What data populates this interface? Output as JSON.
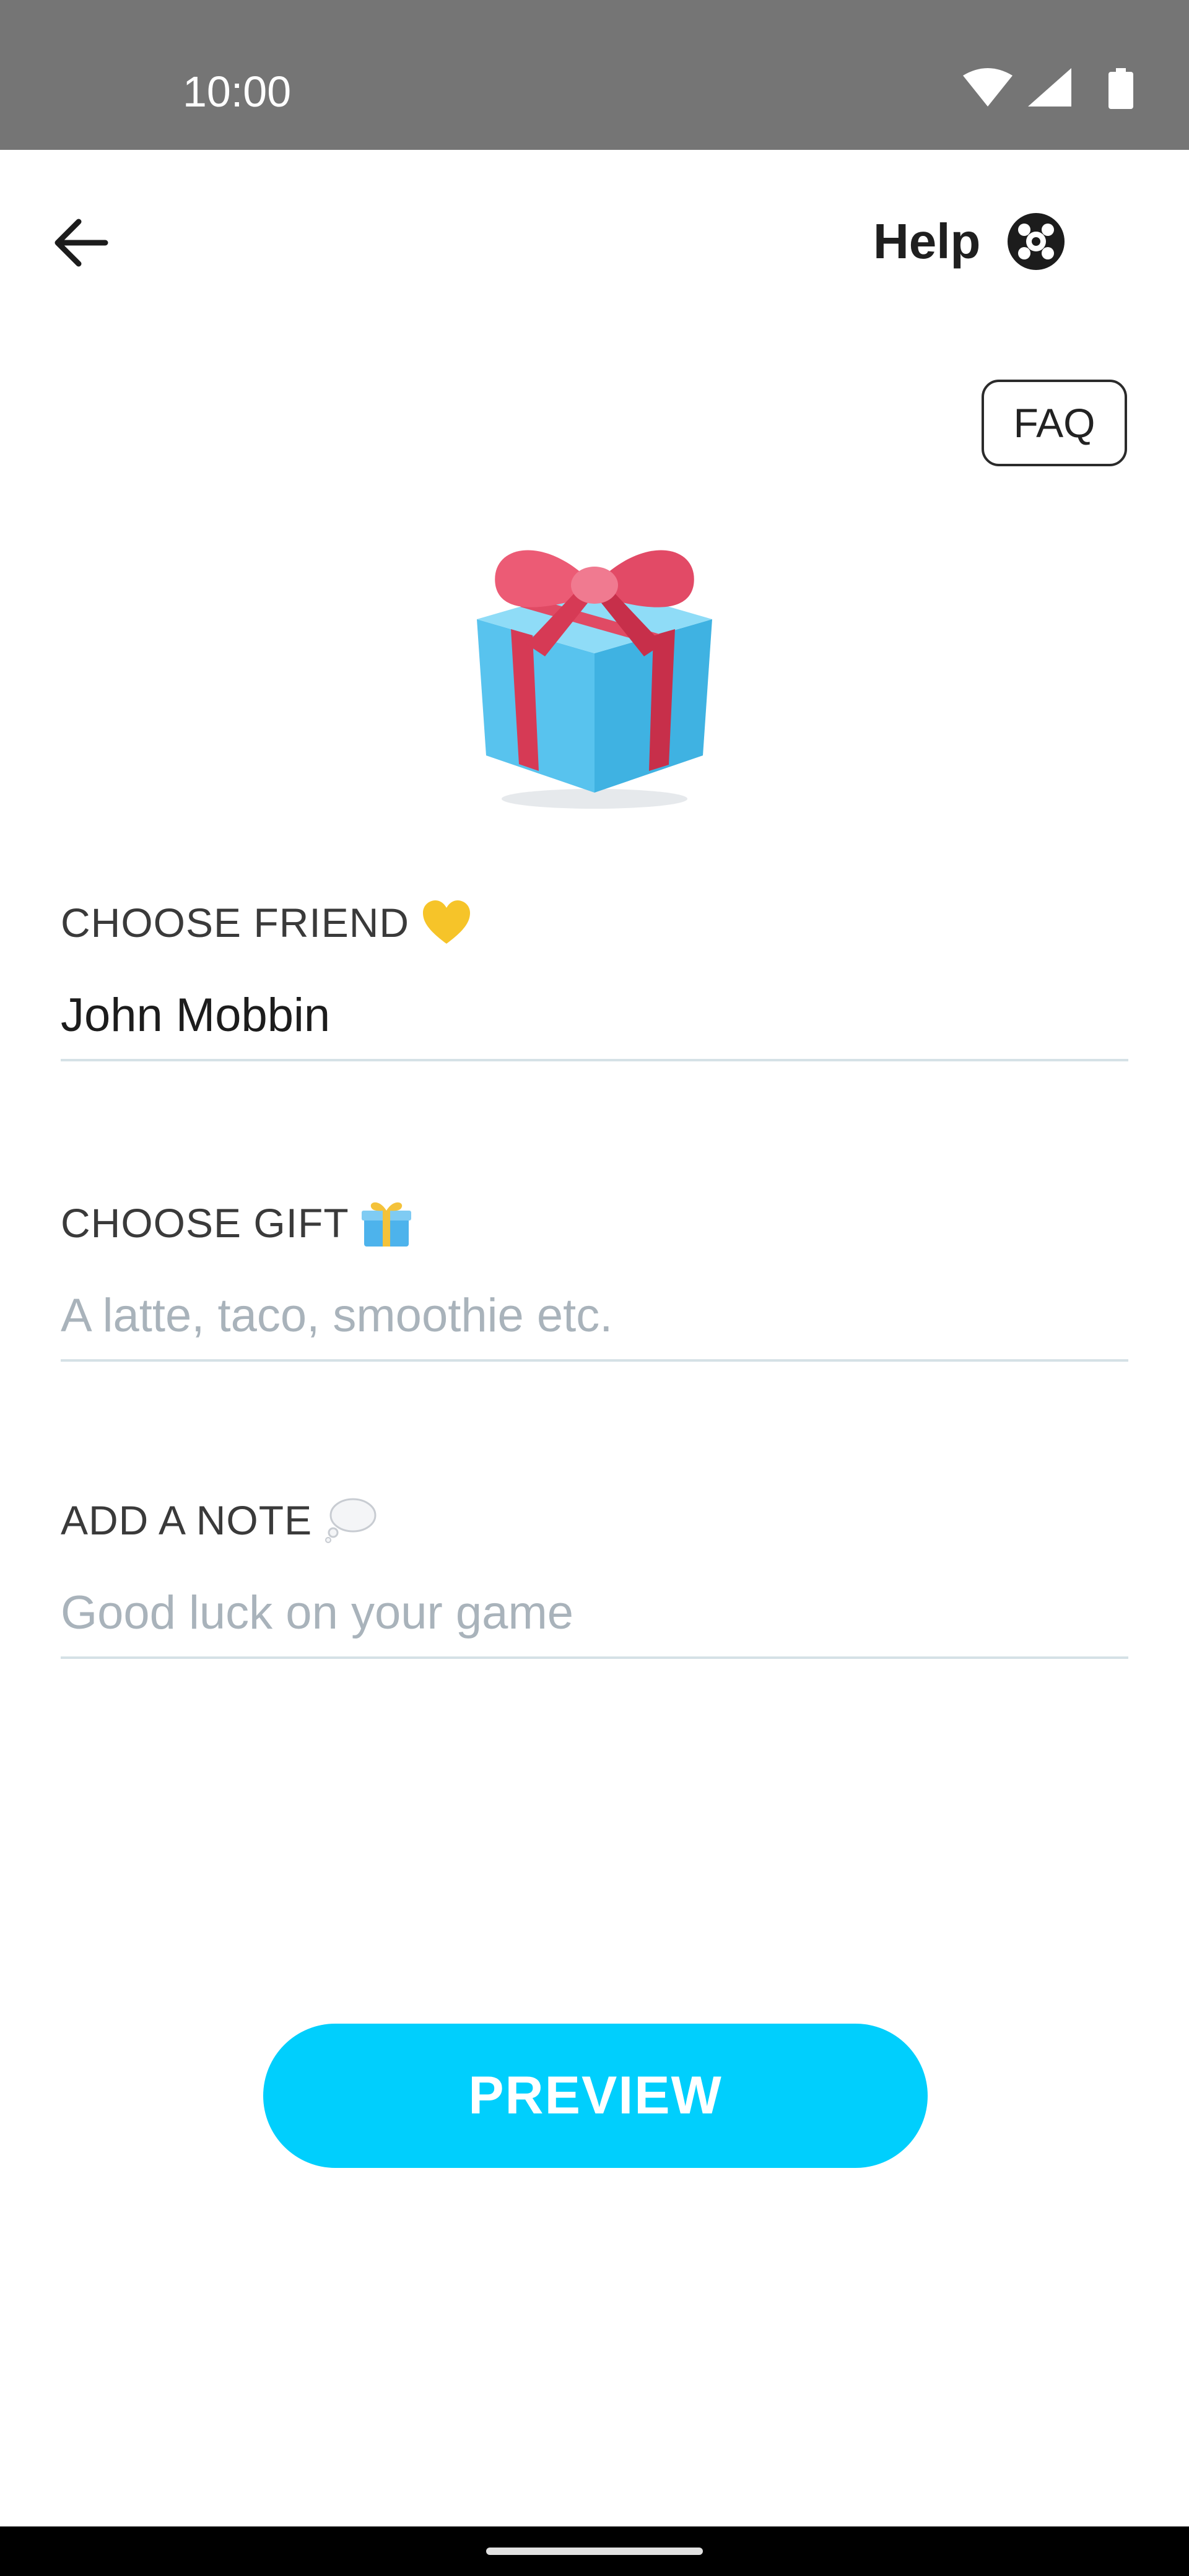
{
  "status_bar": {
    "time": "10:00",
    "icons": [
      "wifi-icon",
      "cellular-signal-icon",
      "battery-icon"
    ],
    "background": "#757575"
  },
  "app_bar": {
    "back_icon": "arrow-left-icon",
    "help_label": "Help",
    "help_icon": "help-lifebuoy-icon"
  },
  "faq_button": {
    "label": "FAQ"
  },
  "illustration": {
    "icon": "gift-box-icon",
    "colors": {
      "box": "#5ec8f2",
      "ribbon": "#e0455f"
    }
  },
  "form": {
    "friend": {
      "label": "CHOOSE FRIEND",
      "emoji_icon": "yellow-heart-icon",
      "value": "John Mobbin",
      "placeholder": ""
    },
    "gift": {
      "label": "CHOOSE GIFT",
      "emoji_icon": "wrapped-gift-icon",
      "value": "",
      "placeholder": "A latte, taco, smoothie etc."
    },
    "note": {
      "label": "ADD A NOTE",
      "emoji_icon": "thought-balloon-icon",
      "value": "",
      "placeholder": "Good luck on your game"
    }
  },
  "preview_button": {
    "label": "PREVIEW",
    "color": "#00cffd"
  },
  "colors": {
    "accent": "#00cffd",
    "underline": "#d5e1e6",
    "placeholder": "#a9b3bb"
  }
}
